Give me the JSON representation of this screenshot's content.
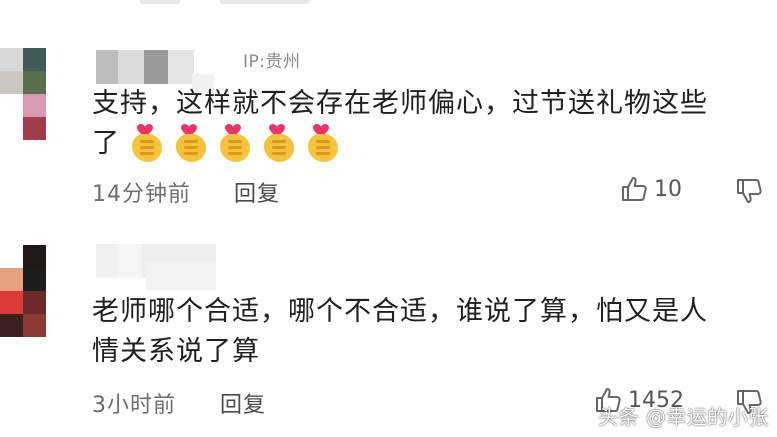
{
  "comments": [
    {
      "region": "IP:贵州",
      "text_line1": "支持，这样就不会存在老师偏心，过节送礼物这些",
      "text_line2": "了",
      "emoji": [
        "finger-heart-emoji",
        "finger-heart-emoji",
        "finger-heart-emoji",
        "finger-heart-emoji",
        "finger-heart-emoji"
      ],
      "time": "14分钟前",
      "reply_label": "回复",
      "like_count": "10"
    },
    {
      "text_line1": "老师哪个合适，哪个不合适，谁说了算，怕又是人",
      "text_line2": "情关系说了算",
      "time": "3小时前",
      "reply_label": "回复",
      "like_count": "1452"
    }
  ],
  "watermark": "头条 @幸运的小张",
  "colors": {
    "heart": "#e8356a",
    "emoji_hand": "#f6c23d",
    "muted_text": "#8a8a8a"
  }
}
